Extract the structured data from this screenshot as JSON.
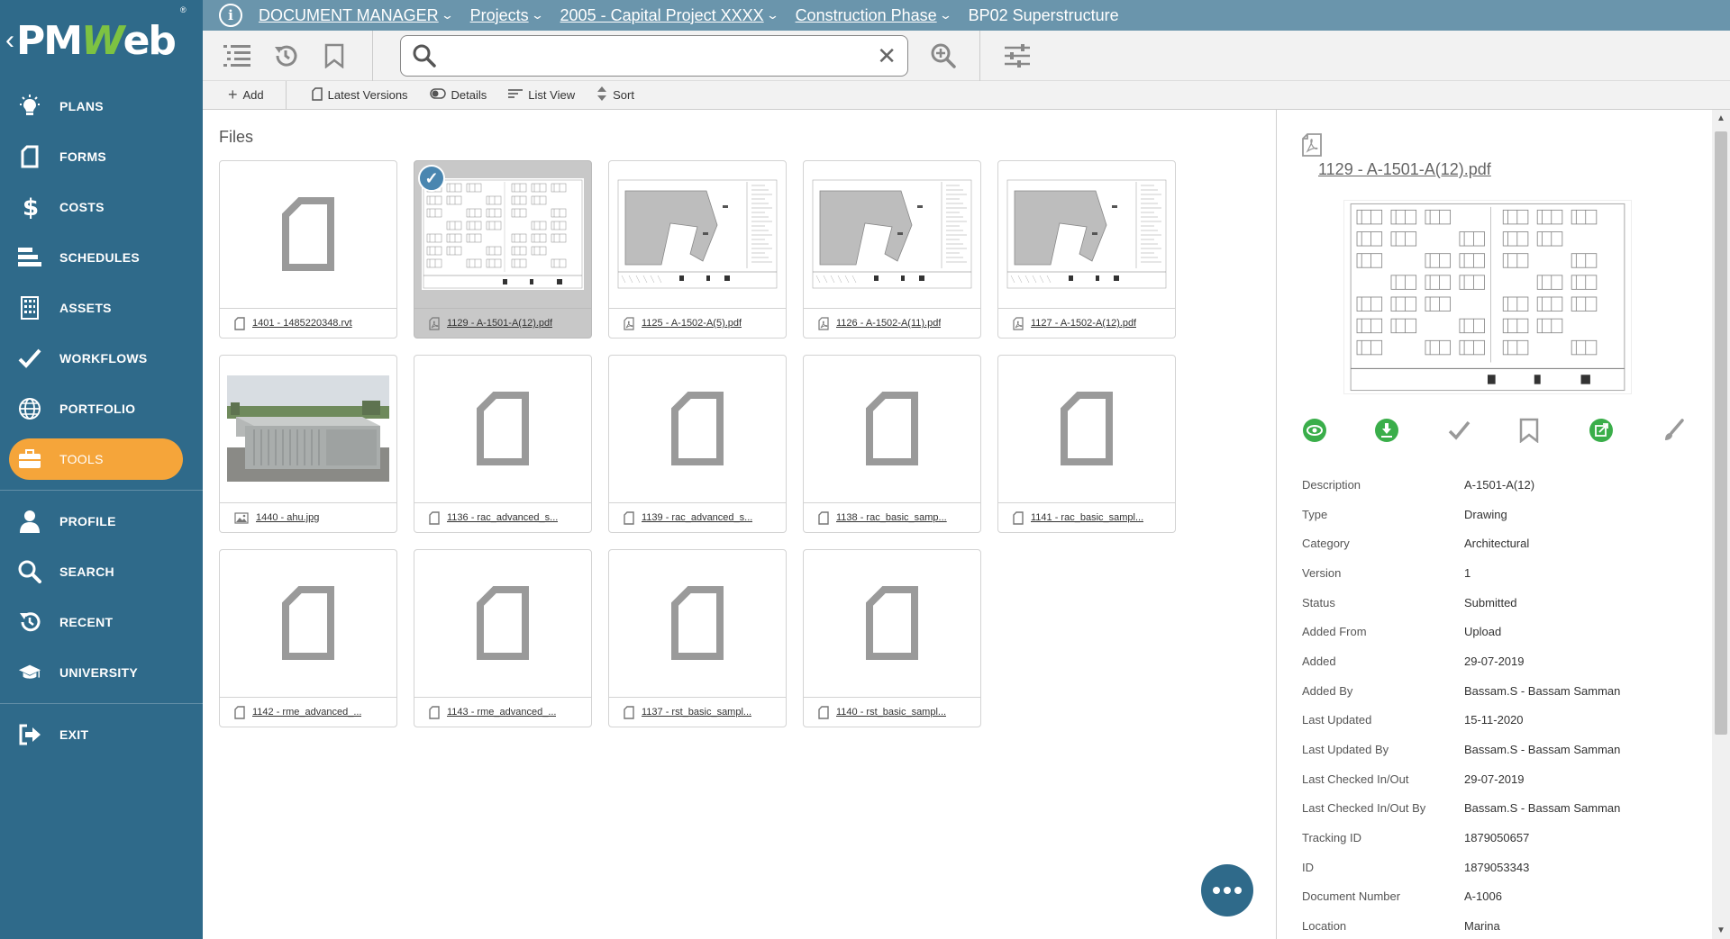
{
  "app": {
    "logo_text_1": "PM",
    "logo_text_2": "W",
    "logo_text_3": "eb",
    "logo_reg": "®"
  },
  "sidebar": {
    "items": [
      {
        "label": "PLANS",
        "icon": "lightbulb-icon"
      },
      {
        "label": "FORMS",
        "icon": "form-icon"
      },
      {
        "label": "COSTS",
        "icon": "dollar-icon"
      },
      {
        "label": "SCHEDULES",
        "icon": "schedule-icon"
      },
      {
        "label": "ASSETS",
        "icon": "building-icon"
      },
      {
        "label": "WORKFLOWS",
        "icon": "check-icon"
      },
      {
        "label": "PORTFOLIO",
        "icon": "globe-icon"
      },
      {
        "label": "TOOLS",
        "icon": "briefcase-icon",
        "active": true
      },
      {
        "label": "PROFILE",
        "icon": "user-icon"
      },
      {
        "label": "SEARCH",
        "icon": "search-icon"
      },
      {
        "label": "RECENT",
        "icon": "history-icon"
      },
      {
        "label": "UNIVERSITY",
        "icon": "graduation-cap-icon"
      },
      {
        "label": "EXIT",
        "icon": "exit-icon"
      }
    ]
  },
  "breadcrumb": {
    "items": [
      "DOCUMENT MANAGER",
      "Projects",
      "2005 - Capital Project XXXX",
      "Construction Phase"
    ],
    "current": "BP02 Superstructure"
  },
  "search": {
    "value": "",
    "placeholder": ""
  },
  "actionbar": {
    "add": "Add",
    "latest_versions": "Latest Versions",
    "details": "Details",
    "list_view": "List View",
    "sort": "Sort"
  },
  "files": {
    "title": "Files",
    "items": [
      {
        "name": "1401 - 1485220348.rvt",
        "kind": "generic",
        "thumb": "blank"
      },
      {
        "name": "1129 - A-1501-A(12).pdf",
        "kind": "pdf",
        "thumb": "drawing-detail",
        "selected": true
      },
      {
        "name": "1125 - A-1502-A(5).pdf",
        "kind": "pdf",
        "thumb": "drawing-plan"
      },
      {
        "name": "1126 - A-1502-A(11).pdf",
        "kind": "pdf",
        "thumb": "drawing-plan"
      },
      {
        "name": "1127 - A-1502-A(12).pdf",
        "kind": "pdf",
        "thumb": "drawing-plan"
      },
      {
        "name": "1440 - ahu.jpg",
        "kind": "image",
        "thumb": "photo"
      },
      {
        "name": "1136 - rac_advanced_s...",
        "kind": "generic",
        "thumb": "blank"
      },
      {
        "name": "1139 - rac_advanced_s...",
        "kind": "generic",
        "thumb": "blank"
      },
      {
        "name": "1138 - rac_basic_samp...",
        "kind": "generic",
        "thumb": "blank"
      },
      {
        "name": "1141 - rac_basic_sampl...",
        "kind": "generic",
        "thumb": "blank"
      },
      {
        "name": "1142 - rme_advanced_...",
        "kind": "generic",
        "thumb": "blank"
      },
      {
        "name": "1143 - rme_advanced_...",
        "kind": "generic",
        "thumb": "blank"
      },
      {
        "name": "1137 - rst_basic_sampl...",
        "kind": "generic",
        "thumb": "blank"
      },
      {
        "name": "1140 - rst_basic_sampl...",
        "kind": "generic",
        "thumb": "blank"
      }
    ]
  },
  "details": {
    "title": "1129 - A-1501-A(12).pdf",
    "actions": [
      "view-icon",
      "download-icon",
      "approve-icon",
      "bookmark-icon",
      "open-external-icon",
      "markup-brush-icon"
    ],
    "properties": [
      {
        "key": "Description",
        "value": "A-1501-A(12)"
      },
      {
        "key": "Type",
        "value": "Drawing"
      },
      {
        "key": "Category",
        "value": "Architectural"
      },
      {
        "key": "Version",
        "value": "1"
      },
      {
        "key": "Status",
        "value": "Submitted"
      },
      {
        "key": "Added From",
        "value": "Upload"
      },
      {
        "key": "Added",
        "value": "29-07-2019"
      },
      {
        "key": "Added By",
        "value": "Bassam.S - Bassam Samman"
      },
      {
        "key": "Last Updated",
        "value": "15-11-2020"
      },
      {
        "key": "Last Updated By",
        "value": "Bassam.S - Bassam Samman"
      },
      {
        "key": "Last Checked In/Out",
        "value": "29-07-2019"
      },
      {
        "key": "Last Checked In/Out By",
        "value": "Bassam.S - Bassam Samman"
      },
      {
        "key": "Tracking ID",
        "value": "1879050657"
      },
      {
        "key": "ID",
        "value": "1879053343"
      },
      {
        "key": "Document Number",
        "value": "A-1006"
      },
      {
        "key": "Location",
        "value": "Marina"
      }
    ]
  },
  "colors": {
    "sidebar": "#2f6a8a",
    "topbar": "#6a95ac",
    "active": "#f5a53a",
    "green_action": "#3aae4a",
    "logo_accent": "#7dc242"
  }
}
